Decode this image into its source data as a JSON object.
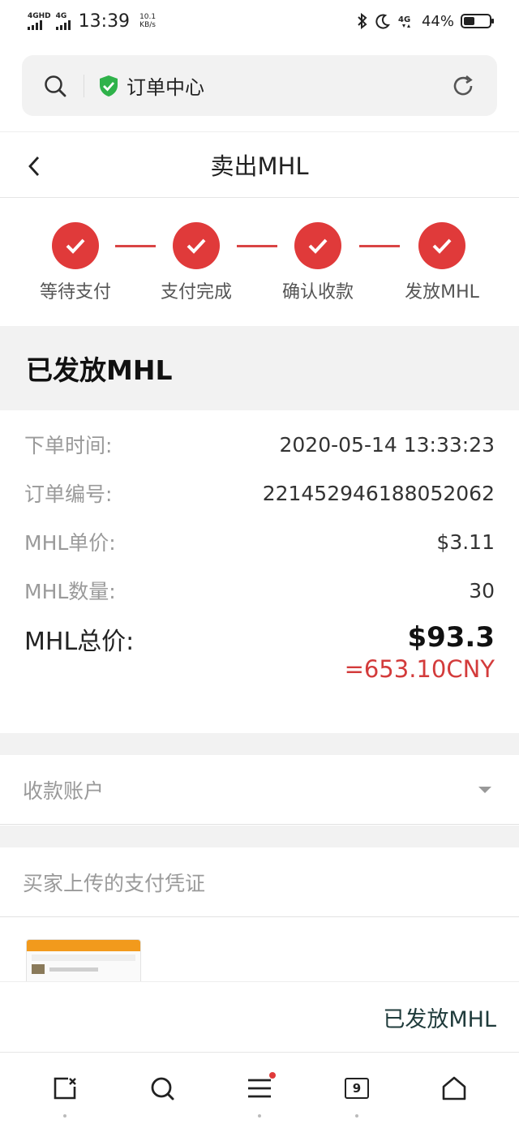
{
  "status_bar": {
    "network1": "4GHD",
    "network2": "4G",
    "time": "13:39",
    "speed_value": "10.1",
    "speed_unit": "KB/s",
    "battery": "44%",
    "battery_level": 0.44
  },
  "url_bar": {
    "title": "订单中心"
  },
  "header": {
    "title": "卖出MHL"
  },
  "steps": [
    {
      "label": "等待支付",
      "done": true
    },
    {
      "label": "支付完成",
      "done": true
    },
    {
      "label": "确认收款",
      "done": true
    },
    {
      "label": "发放MHL",
      "done": true
    }
  ],
  "status_banner": "已发放MHL",
  "details": {
    "order_time_label": "下单时间:",
    "order_time": "2020-05-14 13:33:23",
    "order_no_label": "订单编号:",
    "order_no": "221452946188052062",
    "unit_price_label": "MHL单价:",
    "unit_price": "$3.11",
    "quantity_label": "MHL数量:",
    "quantity": "30",
    "total_label": "MHL总价:",
    "total_usd": "$93.3",
    "total_cny": "=653.10CNY"
  },
  "receiving_account_label": "收款账户",
  "payment_proof_label": "买家上传的支付凭证",
  "action_button": "已发放MHL",
  "bottom_nav": {
    "tabs_count": "9"
  },
  "colors": {
    "accent_red": "#e03a3a",
    "shield_green": "#2fb24a"
  }
}
